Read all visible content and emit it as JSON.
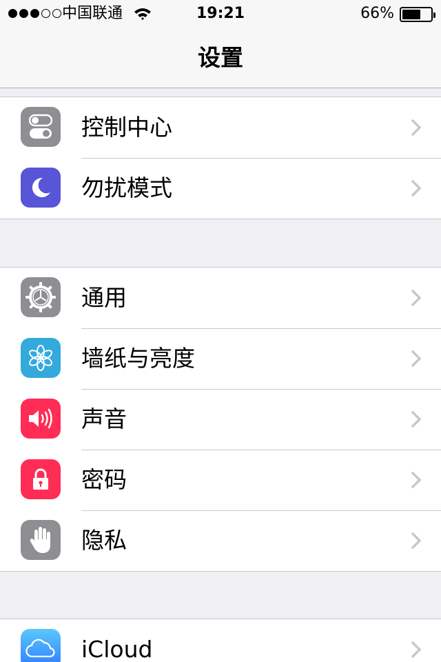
{
  "status_bar": {
    "carrier": "中国联通",
    "time": "19:21",
    "battery_percent": "66%",
    "battery_level": 0.66,
    "signal_bars_filled": 3,
    "signal_bars_total": 5
  },
  "nav": {
    "title": "设置"
  },
  "groups": [
    {
      "items": [
        {
          "label": "控制中心",
          "icon": "control-center-icon",
          "color": "#8e8e93"
        },
        {
          "label": "勿扰模式",
          "icon": "moon-icon",
          "color": "#5856d6"
        }
      ]
    },
    {
      "items": [
        {
          "label": "通用",
          "icon": "gear-icon",
          "color": "#8e8e93"
        },
        {
          "label": "墙纸与亮度",
          "icon": "flower-icon",
          "color": "#34aadc"
        },
        {
          "label": "声音",
          "icon": "speaker-icon",
          "color": "#ff2d55"
        },
        {
          "label": "密码",
          "icon": "lock-icon",
          "color": "#ff2d55"
        },
        {
          "label": "隐私",
          "icon": "hand-icon",
          "color": "#8e8e93"
        }
      ]
    },
    {
      "items": [
        {
          "label": "iCloud",
          "icon": "cloud-icon",
          "color": "#2f7dff"
        }
      ]
    }
  ]
}
